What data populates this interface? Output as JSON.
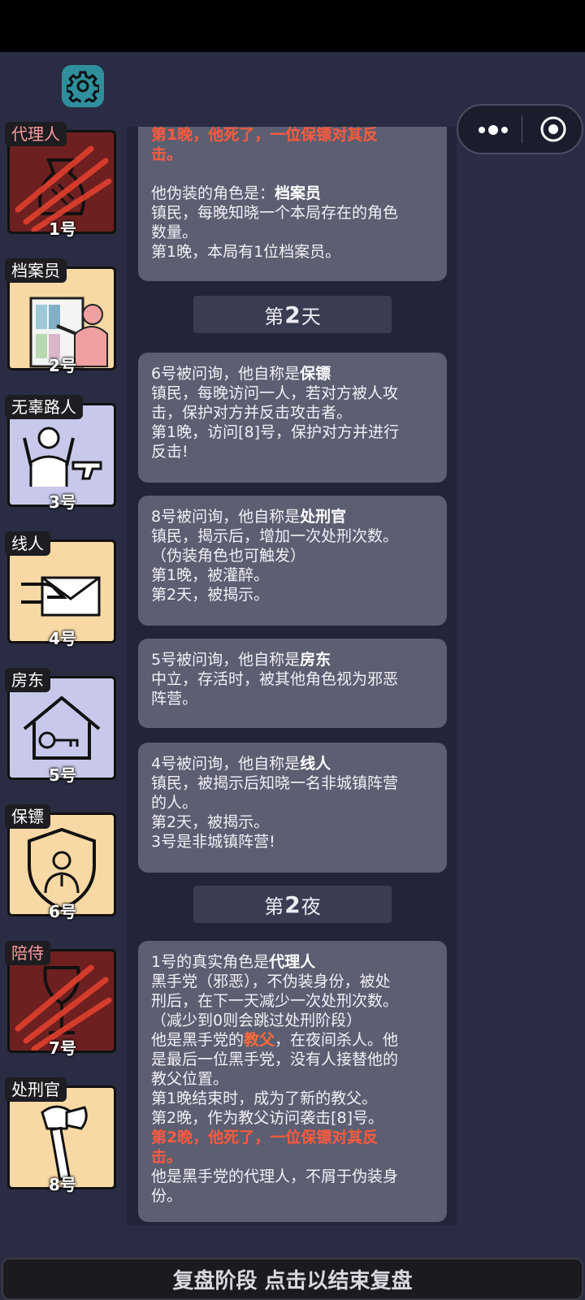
{
  "capsule": {
    "more_icon": "more-dots-icon",
    "close_icon": "target-icon"
  },
  "players": [
    {
      "role": "代理人",
      "num": "1号",
      "dead": true,
      "bg": "#6e2020",
      "icon": "money-bag-icon"
    },
    {
      "role": "档案员",
      "num": "2号",
      "dead": false,
      "bg": "#f8d8a4",
      "icon": "bookshelf-icon"
    },
    {
      "role": "无辜路人",
      "num": "3号",
      "dead": false,
      "bg": "#c8c8ec",
      "icon": "hands-up-gun-icon"
    },
    {
      "role": "线人",
      "num": "4号",
      "dead": false,
      "bg": "#f8d8a4",
      "icon": "envelope-hand-icon"
    },
    {
      "role": "房东",
      "num": "5号",
      "dead": false,
      "bg": "#c8c8ec",
      "icon": "house-key-icon"
    },
    {
      "role": "保镖",
      "num": "6号",
      "dead": false,
      "bg": "#f8d8a4",
      "icon": "shield-person-icon"
    },
    {
      "role": "陪侍",
      "num": "7号",
      "dead": true,
      "bg": "#6e2020",
      "icon": "wine-glass-icon"
    },
    {
      "role": "处刑官",
      "num": "8号",
      "dead": false,
      "bg": "#f8d8a4",
      "icon": "axe-icon"
    }
  ],
  "feed": {
    "card0": {
      "l1": "第1晚，他死了，一位保镖对其反",
      "l2": "击。",
      "l3a": "他伪装的角色是：",
      "l3b": "档案员",
      "l4": "镇民，每晚知晓一个本局存在的角色",
      "l5": "数量。",
      "l6": "第1晚，本局有1位档案员。"
    },
    "day2": {
      "pre": "第",
      "num": "2",
      "post": "天"
    },
    "card1": {
      "l1a": "6号被问询，他自称是",
      "l1b": "保镖",
      "l2": "镇民，每晚访问一人，若对方被人攻",
      "l3": "击，保护对方并反击攻击者。",
      "l4": "第1晚，访问[8]号，保护对方并进行",
      "l5": "反击!"
    },
    "card2": {
      "l1a": "8号被问询，他自称是",
      "l1b": "处刑官",
      "l2": "镇民，揭示后，增加一次处刑次数。",
      "l3": "（伪装角色也可触发）",
      "l4": "第1晚，被灌醉。",
      "l5": "第2天，被揭示。"
    },
    "card3": {
      "l1a": "5号被问询，他自称是",
      "l1b": "房东",
      "l2": "中立，存活时，被其他角色视为邪恶",
      "l3": "阵营。"
    },
    "card4": {
      "l1a": "4号被问询，他自称是",
      "l1b": "线人",
      "l2": "镇民，被揭示后知晓一名非城镇阵营",
      "l3": "的人。",
      "l4": "第2天，被揭示。",
      "l5": "3号是非城镇阵营!"
    },
    "night2": {
      "pre": "第",
      "num": "2",
      "post": "夜"
    },
    "card5": {
      "l1a": "1号的真实角色是",
      "l1b": "代理人",
      "l2": "黑手党（邪恶），不伪装身份，被处",
      "l3": "刑后，在下一天减少一次处刑次数。",
      "l4": "（减少到0则会跳过处刑阶段）",
      "l5a": "他是黑手党的",
      "l5b": "教父",
      "l5c": "，在夜间杀人。他",
      "l6": "是最后一位黑手党，没有人接替他的",
      "l7": "教父位置。",
      "l8": "第1晚结束时，成为了新的教父。",
      "l9": "第2晚，作为教父访问袭击[8]号。",
      "l10": "第2晚，他死了，一位保镖对其反",
      "l11": "击。",
      "l12": "他是黑手党的代理人，不屑于伪装身",
      "l13": "份。"
    }
  },
  "bottom": {
    "label": "复盘阶段 点击以结束复盘"
  }
}
